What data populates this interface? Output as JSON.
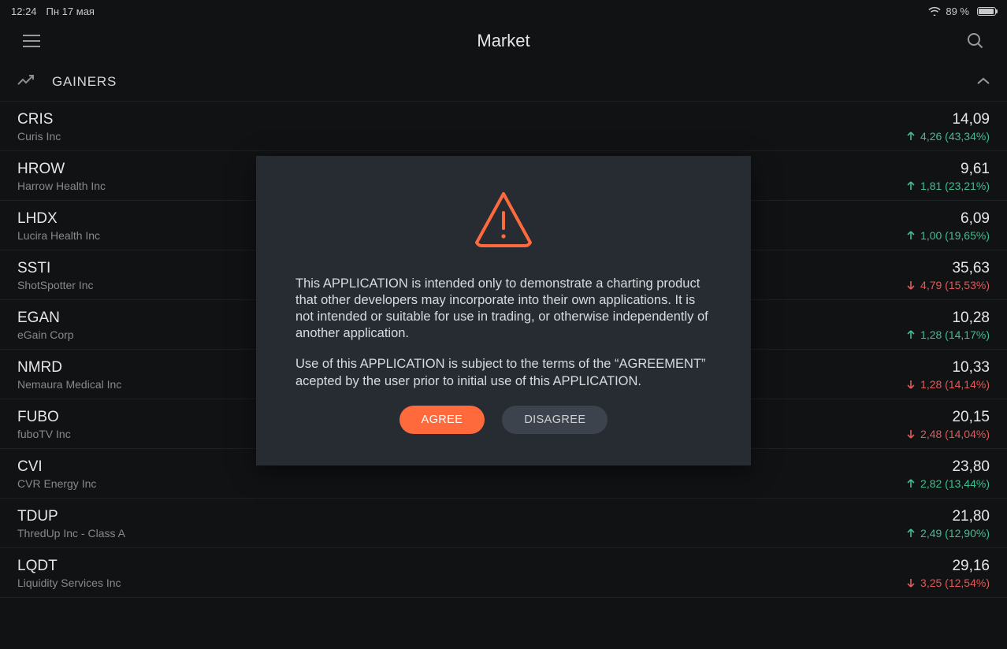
{
  "status_bar": {
    "time": "12:24",
    "date": "Пн 17 мая",
    "battery_percent": "89 %"
  },
  "header": {
    "title": "Market"
  },
  "section": {
    "label": "GAINERS"
  },
  "colors": {
    "up": "#3fbf8f",
    "down": "#e05a5a",
    "accent": "#ff6a3d"
  },
  "stocks": [
    {
      "ticker": "CRIS",
      "company": "Curis Inc",
      "price": "14,09",
      "change": "4,26 (43,34%)",
      "direction": "up"
    },
    {
      "ticker": "HROW",
      "company": "Harrow Health Inc",
      "price": "9,61",
      "change": "1,81 (23,21%)",
      "direction": "up"
    },
    {
      "ticker": "LHDX",
      "company": "Lucira Health Inc",
      "price": "6,09",
      "change": "1,00 (19,65%)",
      "direction": "up"
    },
    {
      "ticker": "SSTI",
      "company": "ShotSpotter Inc",
      "price": "35,63",
      "change": "4,79 (15,53%)",
      "direction": "down"
    },
    {
      "ticker": "EGAN",
      "company": "eGain Corp",
      "price": "10,28",
      "change": "1,28 (14,17%)",
      "direction": "up"
    },
    {
      "ticker": "NMRD",
      "company": "Nemaura Medical Inc",
      "price": "10,33",
      "change": "1,28 (14,14%)",
      "direction": "down"
    },
    {
      "ticker": "FUBO",
      "company": "fuboTV Inc",
      "price": "20,15",
      "change": "2,48 (14,04%)",
      "direction": "down"
    },
    {
      "ticker": "CVI",
      "company": "CVR Energy Inc",
      "price": "23,80",
      "change": "2,82 (13,44%)",
      "direction": "up"
    },
    {
      "ticker": "TDUP",
      "company": "ThredUp Inc - Class A",
      "price": "21,80",
      "change": "2,49 (12,90%)",
      "direction": "up"
    },
    {
      "ticker": "LQDT",
      "company": "Liquidity Services Inc",
      "price": "29,16",
      "change": "3,25 (12,54%)",
      "direction": "down"
    }
  ],
  "modal": {
    "paragraph1": "This APPLICATION is intended only to demonstrate a charting product that other developers may incorporate into their own applications. It is not intended or suitable for use in trading, or otherwise independently of another application.",
    "paragraph2": "Use of this APPLICATION is subject to the terms of the “AGREEMENT” acepted by the user prior to initial use of this APPLICATION.",
    "agree_label": "AGREE",
    "disagree_label": "DISAGREE"
  }
}
